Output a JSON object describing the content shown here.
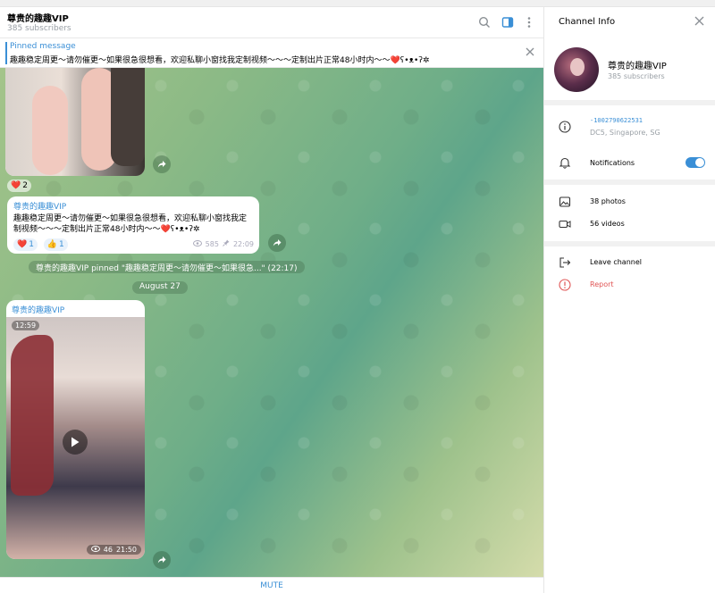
{
  "chat": {
    "title": "尊贵的趣趣VIP",
    "subscribers": "385 subscribers",
    "header_icons": [
      "search-icon",
      "sidebar-toggle-icon",
      "more-vertical-icon"
    ],
    "pinned": {
      "label": "Pinned message",
      "text": "趣趣稳定周更～请勿催更～如果很急很想看，欢迎私聊小窗找我定制视频～～～定制出片正常48小时内～～❤️ʕ•ᴥ•ʔ✲"
    },
    "messages": [
      {
        "type": "photo",
        "reaction": {
          "emoji": "❤️",
          "count": "2"
        }
      },
      {
        "type": "text",
        "author": "尊贵的趣趣VIP",
        "text": "趣趣稳定周更～请勿催更～如果很急很想看，欢迎私聊小窗找我定制视频～～～定制出片正常48小时内～～❤️ʕ•ᴥ•ʔ✲",
        "reactions": [
          {
            "emoji": "❤️",
            "count": "1"
          },
          {
            "emoji": "👍",
            "count": "1"
          }
        ],
        "views": "585",
        "time": "22:09"
      }
    ],
    "service": "尊贵的趣趣VIP pinned \"趣趣稳定周更～请勿催更～如果很急...\" (22:17)",
    "date_divider": "August 27",
    "video_message": {
      "author": "尊贵的趣趣VIP",
      "duration": "12:59",
      "views": "46",
      "time": "21:50"
    },
    "mute_label": "MUTE"
  },
  "info": {
    "panel_title": "Channel Info",
    "name": "尊贵的趣趣VIP",
    "subscribers": "385 subscribers",
    "id": "-1002790622531",
    "dc": "DC5, Singapore, SG",
    "notifications_label": "Notifications",
    "notifications_on": true,
    "photos": "38 photos",
    "videos": "56 videos",
    "leave": "Leave channel",
    "report": "Report"
  },
  "colors": {
    "accent": "#3a8fd6",
    "danger": "#e05555"
  }
}
